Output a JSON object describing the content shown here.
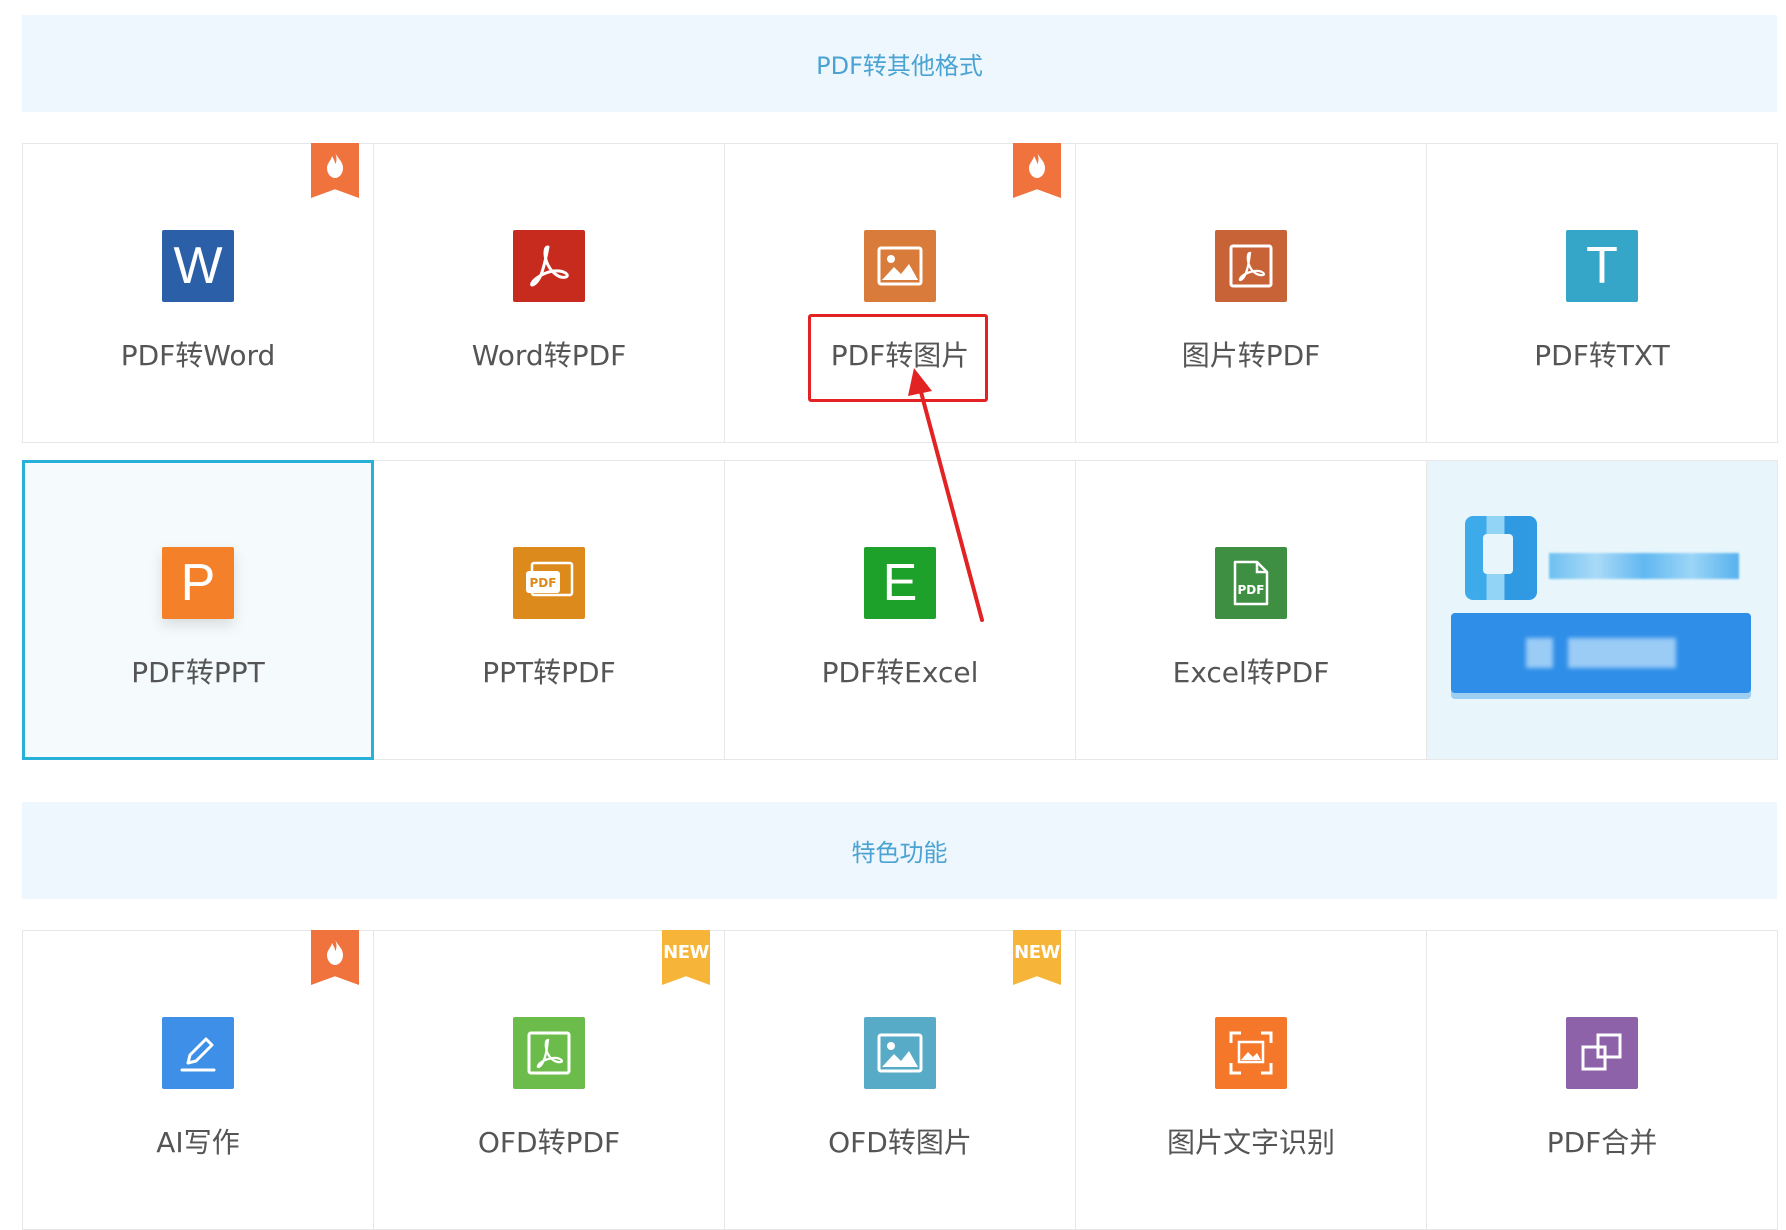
{
  "sections": [
    {
      "title": "PDF转其他格式"
    },
    {
      "title": "特色功能"
    }
  ],
  "tools": {
    "pdf_to_word": {
      "label": "PDF转Word",
      "letter": "W",
      "icon": "word-doc-icon",
      "color": "#2b5fa8",
      "badge": "hot"
    },
    "word_to_pdf": {
      "label": "Word转PDF",
      "icon": "acrobat-icon",
      "color": "#c62b1e"
    },
    "pdf_to_image": {
      "label": "PDF转图片",
      "icon": "image-icon",
      "color": "#d97b3a",
      "badge": "hot"
    },
    "image_to_pdf": {
      "label": "图片转PDF",
      "icon": "pdf-framed-icon",
      "color": "#c76337"
    },
    "pdf_to_txt": {
      "label": "PDF转TXT",
      "letter": "T",
      "icon": "text-t-icon",
      "color": "#35a6c7"
    },
    "pdf_to_ppt": {
      "label": "PDF转PPT",
      "letter": "P",
      "icon": "powerpoint-icon",
      "color": "#f5802a",
      "selected": true
    },
    "ppt_to_pdf": {
      "label": "PPT转PDF",
      "icon": "ppt-pdf-icon",
      "color": "#dd8a1c",
      "pdf_tag": "PDF"
    },
    "pdf_to_excel": {
      "label": "PDF转Excel",
      "letter": "E",
      "icon": "excel-icon",
      "color": "#1ea12a"
    },
    "excel_to_pdf": {
      "label": "Excel转PDF",
      "icon": "pdf-file-icon",
      "color": "#3f8f43",
      "pdf_tag": "PDF"
    },
    "ai_writing": {
      "label": "AI写作",
      "icon": "pen-edit-icon",
      "color": "#3d8fe8",
      "badge": "hot"
    },
    "ofd_to_pdf": {
      "label": "OFD转PDF",
      "icon": "acrobat-icon",
      "color": "#6cbc4b",
      "badge": "new"
    },
    "ofd_to_image": {
      "label": "OFD转图片",
      "icon": "image-icon",
      "color": "#58abc6",
      "badge": "new"
    },
    "image_ocr": {
      "label": "图片文字识别",
      "icon": "scan-image-icon",
      "color": "#f5782a"
    },
    "pdf_merge": {
      "label": "PDF合并",
      "icon": "merge-squares-icon",
      "color": "#8d62a9"
    }
  },
  "badges": {
    "new_text": "NEW",
    "hot_color": "#f0733d",
    "new_color": "#f6b538"
  },
  "annotation": {
    "color": "#e32323",
    "highlight_target": "PDF转图片"
  }
}
